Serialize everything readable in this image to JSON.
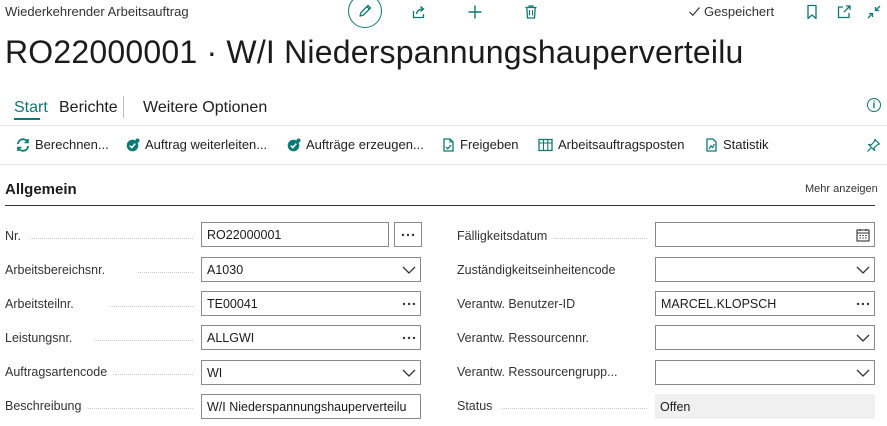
{
  "header": {
    "caption": "Wiederkehrender Arbeitsauftrag",
    "saved_label": "Gespeichert",
    "title": "RO22000001 · W/I Niederspannungshauperverteilu"
  },
  "tabs": [
    {
      "label": "Start"
    },
    {
      "label": "Berichte"
    },
    {
      "label": "Weitere Optionen"
    }
  ],
  "actions": [
    {
      "label": "Berechnen...",
      "icon": "refresh-icon"
    },
    {
      "label": "Auftrag weiterleiten...",
      "icon": "badge-check-icon"
    },
    {
      "label": "Aufträge erzeugen...",
      "icon": "badge-check-icon"
    },
    {
      "label": "Freigeben",
      "icon": "document-icon"
    },
    {
      "label": "Arbeitsauftragsposten",
      "icon": "table-icon"
    },
    {
      "label": "Statistik",
      "icon": "chart-document-icon"
    }
  ],
  "section": {
    "title": "Allgemein",
    "more_label": "Mehr anzeigen"
  },
  "fields_left": [
    {
      "label": "Nr.",
      "value": "RO22000001",
      "control": "assist-edit"
    },
    {
      "label": "Arbeitsbereichsnr.",
      "value": "A1030",
      "control": "dropdown"
    },
    {
      "label": "Arbeitsteilnr.",
      "value": "TE00041",
      "control": "lookup"
    },
    {
      "label": "Leistungsnr.",
      "value": "ALLGWI",
      "control": "lookup"
    },
    {
      "label": "Auftragsartencode",
      "value": "WI",
      "control": "dropdown"
    },
    {
      "label": "Beschreibung",
      "value": "W/I Niederspannungshauperverteilu",
      "control": "text"
    }
  ],
  "fields_right": [
    {
      "label": "Fälligkeitsdatum",
      "value": "",
      "control": "date"
    },
    {
      "label": "Zuständigkeitseinheitencode",
      "value": "",
      "control": "dropdown"
    },
    {
      "label": "Verantw. Benutzer-ID",
      "value": "MARCEL.KLOPSCH",
      "control": "lookup"
    },
    {
      "label": "Verantw. Ressourcennr.",
      "value": "",
      "control": "dropdown"
    },
    {
      "label": "Verantw. Ressourcengrupp...",
      "value": "",
      "control": "dropdown"
    },
    {
      "label": "Status",
      "value": "Offen",
      "control": "readonly"
    }
  ],
  "colors": {
    "accent": "#0b7a75",
    "text": "#212121",
    "border": "#8a8a8a",
    "readonly_bg": "#f0f0f0"
  }
}
